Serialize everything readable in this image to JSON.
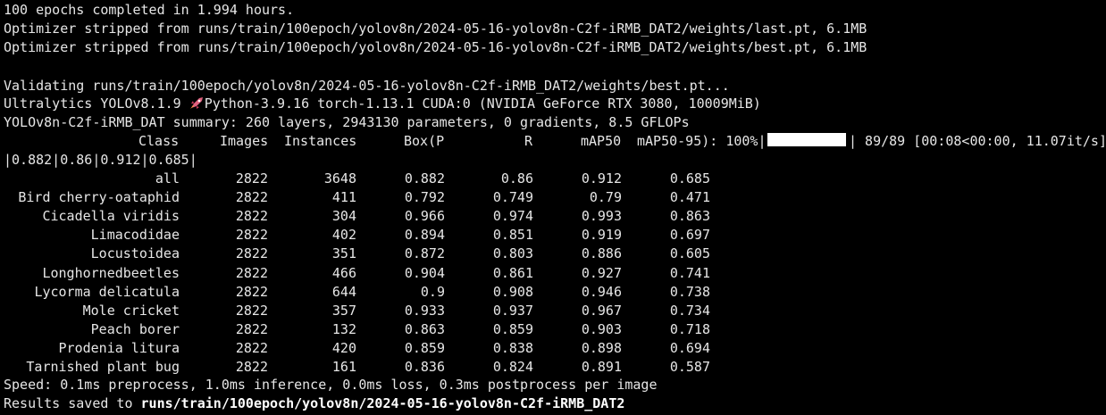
{
  "terminal": {
    "lines": [
      "100 epochs completed in 1.994 hours.",
      "Optimizer stripped from runs/train/100epoch/yolov8n/2024-05-16-yolov8n-C2f-iRMB_DAT2/weights/last.pt, 6.1MB",
      "Optimizer stripped from runs/train/100epoch/yolov8n/2024-05-16-yolov8n-C2f-iRMB_DAT2/weights/best.pt, 6.1MB",
      "",
      "Validating runs/train/100epoch/yolov8n/2024-05-16-yolov8n-C2f-iRMB_DAT2/weights/best.pt...",
      "",
      "YOLOv8n-C2f-iRMB_DAT summary: 260 layers, 2943130 parameters, 0 gradients, 8.5 GFLOPs"
    ],
    "ultralytics_line": {
      "prefix": "Ultralytics YOLOv8.1.9 ",
      "icon": "rocket-icon",
      "suffix": "Python-3.9.16 torch-1.13.1 CUDA:0 (NVIDIA GeForce RTX 3080, 10009MiB)"
    },
    "header": {
      "class": "Class",
      "images": "Images",
      "instances": "Instances",
      "box_p": "Box(P",
      "r": "R",
      "map50": "mAP50",
      "map50_95": "mAP50-95): 100%|",
      "progress_fraction": 1.0,
      "progress_tail": "| 89/89 [00:08<00:00, 11.07it/s]"
    },
    "wrapped_line": "|0.882|0.86|0.912|0.685|",
    "rows": [
      {
        "class": "all",
        "images": "2822",
        "instances": "3648",
        "p": "0.882",
        "r": "0.86",
        "map50": "0.912",
        "map50_95": "0.685"
      },
      {
        "class": "Bird cherry-oataphid",
        "images": "2822",
        "instances": "411",
        "p": "0.792",
        "r": "0.749",
        "map50": "0.79",
        "map50_95": "0.471"
      },
      {
        "class": "Cicadella viridis",
        "images": "2822",
        "instances": "304",
        "p": "0.966",
        "r": "0.974",
        "map50": "0.993",
        "map50_95": "0.863"
      },
      {
        "class": "Limacodidae",
        "images": "2822",
        "instances": "402",
        "p": "0.894",
        "r": "0.851",
        "map50": "0.919",
        "map50_95": "0.697"
      },
      {
        "class": "Locustoidea",
        "images": "2822",
        "instances": "351",
        "p": "0.872",
        "r": "0.803",
        "map50": "0.886",
        "map50_95": "0.605"
      },
      {
        "class": "Longhornedbeetles",
        "images": "2822",
        "instances": "466",
        "p": "0.904",
        "r": "0.861",
        "map50": "0.927",
        "map50_95": "0.741"
      },
      {
        "class": "Lycorma delicatula",
        "images": "2822",
        "instances": "644",
        "p": "0.9",
        "r": "0.908",
        "map50": "0.946",
        "map50_95": "0.738"
      },
      {
        "class": "Mole cricket",
        "images": "2822",
        "instances": "357",
        "p": "0.933",
        "r": "0.937",
        "map50": "0.967",
        "map50_95": "0.734"
      },
      {
        "class": "Peach borer",
        "images": "2822",
        "instances": "132",
        "p": "0.863",
        "r": "0.859",
        "map50": "0.903",
        "map50_95": "0.718"
      },
      {
        "class": "Prodenia litura",
        "images": "2822",
        "instances": "420",
        "p": "0.859",
        "r": "0.838",
        "map50": "0.898",
        "map50_95": "0.694"
      },
      {
        "class": "Tarnished plant bug",
        "images": "2822",
        "instances": "161",
        "p": "0.836",
        "r": "0.824",
        "map50": "0.891",
        "map50_95": "0.587"
      }
    ],
    "speed_line": "Speed: 0.1ms preprocess, 1.0ms inference, 0.0ms loss, 0.3ms postprocess per image",
    "results": {
      "prefix": "Results saved to ",
      "path": "runs/train/100epoch/yolov8n/2024-05-16-yolov8n-C2f-iRMB_DAT2"
    }
  }
}
